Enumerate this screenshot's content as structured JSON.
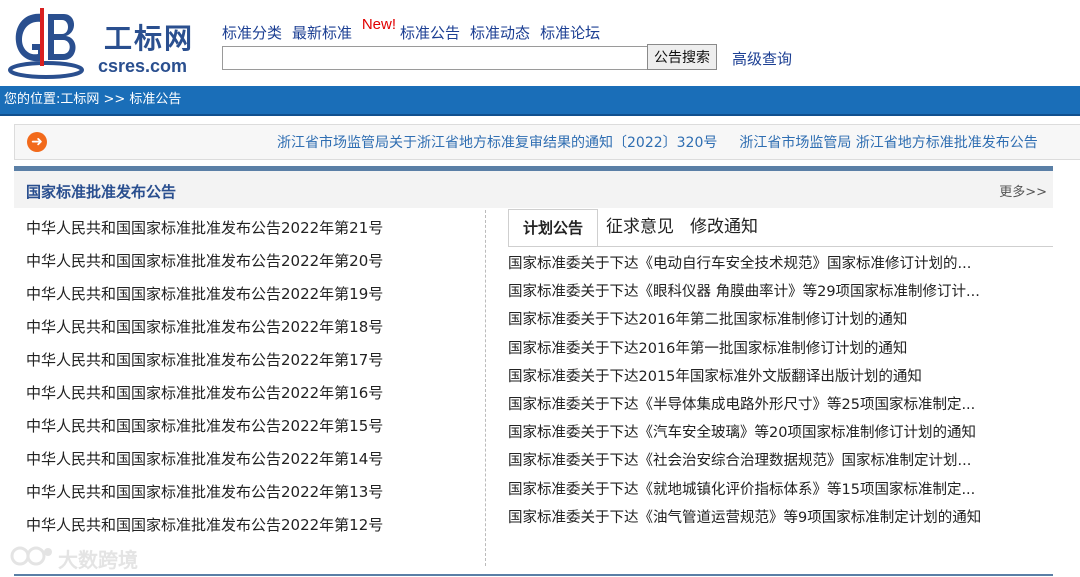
{
  "header": {
    "logo": {
      "cn": "工标网",
      "en": "csres.com"
    },
    "nav": [
      {
        "label": "标准分类"
      },
      {
        "label": "最新标准",
        "badge": "New!"
      },
      {
        "label": "标准公告"
      },
      {
        "label": "标准动态"
      },
      {
        "label": "标准论坛"
      }
    ],
    "search": {
      "value": "",
      "button_label": "公告搜索"
    },
    "advanced_label": "高级查询"
  },
  "breadcrumb": {
    "text": "您的位置:工标网 >> 标准公告"
  },
  "ticker": {
    "icon": "arrow-right-circle-icon",
    "items": [
      "浙江省市场监管局关于浙江省地方标准复审结果的通知〔2022〕320号",
      "浙江省市场监管局 浙江省地方标准批准发布公告"
    ]
  },
  "left_section": {
    "title": "国家标准批准发布公告",
    "more_label": "更多>>",
    "items": [
      "中华人民共和国国家标准批准发布公告2022年第21号",
      "中华人民共和国国家标准批准发布公告2022年第20号",
      "中华人民共和国国家标准批准发布公告2022年第19号",
      "中华人民共和国国家标准批准发布公告2022年第18号",
      "中华人民共和国国家标准批准发布公告2022年第17号",
      "中华人民共和国国家标准批准发布公告2022年第16号",
      "中华人民共和国国家标准批准发布公告2022年第15号",
      "中华人民共和国国家标准批准发布公告2022年第14号",
      "中华人民共和国国家标准批准发布公告2022年第13号",
      "中华人民共和国国家标准批准发布公告2022年第12号"
    ]
  },
  "right_tabs": {
    "tabs": [
      {
        "label": "计划公告",
        "active": true
      },
      {
        "label": "征求意见",
        "active": false
      },
      {
        "label": "修改通知",
        "active": false
      }
    ],
    "items": [
      "国家标准委关于下达《电动自行车安全技术规范》国家标准修订计划的...",
      "国家标准委关于下达《眼科仪器 角膜曲率计》等29项国家标准制修订计...",
      "国家标准委关于下达2016年第二批国家标准制修订计划的通知",
      "国家标准委关于下达2016年第一批国家标准制修订计划的通知",
      "国家标准委关于下达2015年国家标准外文版翻译出版计划的通知",
      "国家标准委关于下达《半导体集成电路外形尺寸》等25项国家标准制定...",
      "国家标准委关于下达《汽车安全玻璃》等20项国家标准制修订计划的通知",
      "国家标准委关于下达《社会治安综合治理数据规范》国家标准制定计划...",
      "国家标准委关于下达《就地城镇化评价指标体系》等15项国家标准制定...",
      "国家标准委关于下达《油气管道运营规范》等9项国家标准制定计划的通知"
    ]
  },
  "watermark": {
    "text": "大数跨境"
  },
  "colors": {
    "brand_blue": "#2a4f8f",
    "link_blue": "#1c3f93",
    "bar_blue": "#1a6eb8",
    "ticker_text": "#2f6eb2",
    "new_red": "#e10000",
    "ticker_icon": "#f26a1b"
  }
}
